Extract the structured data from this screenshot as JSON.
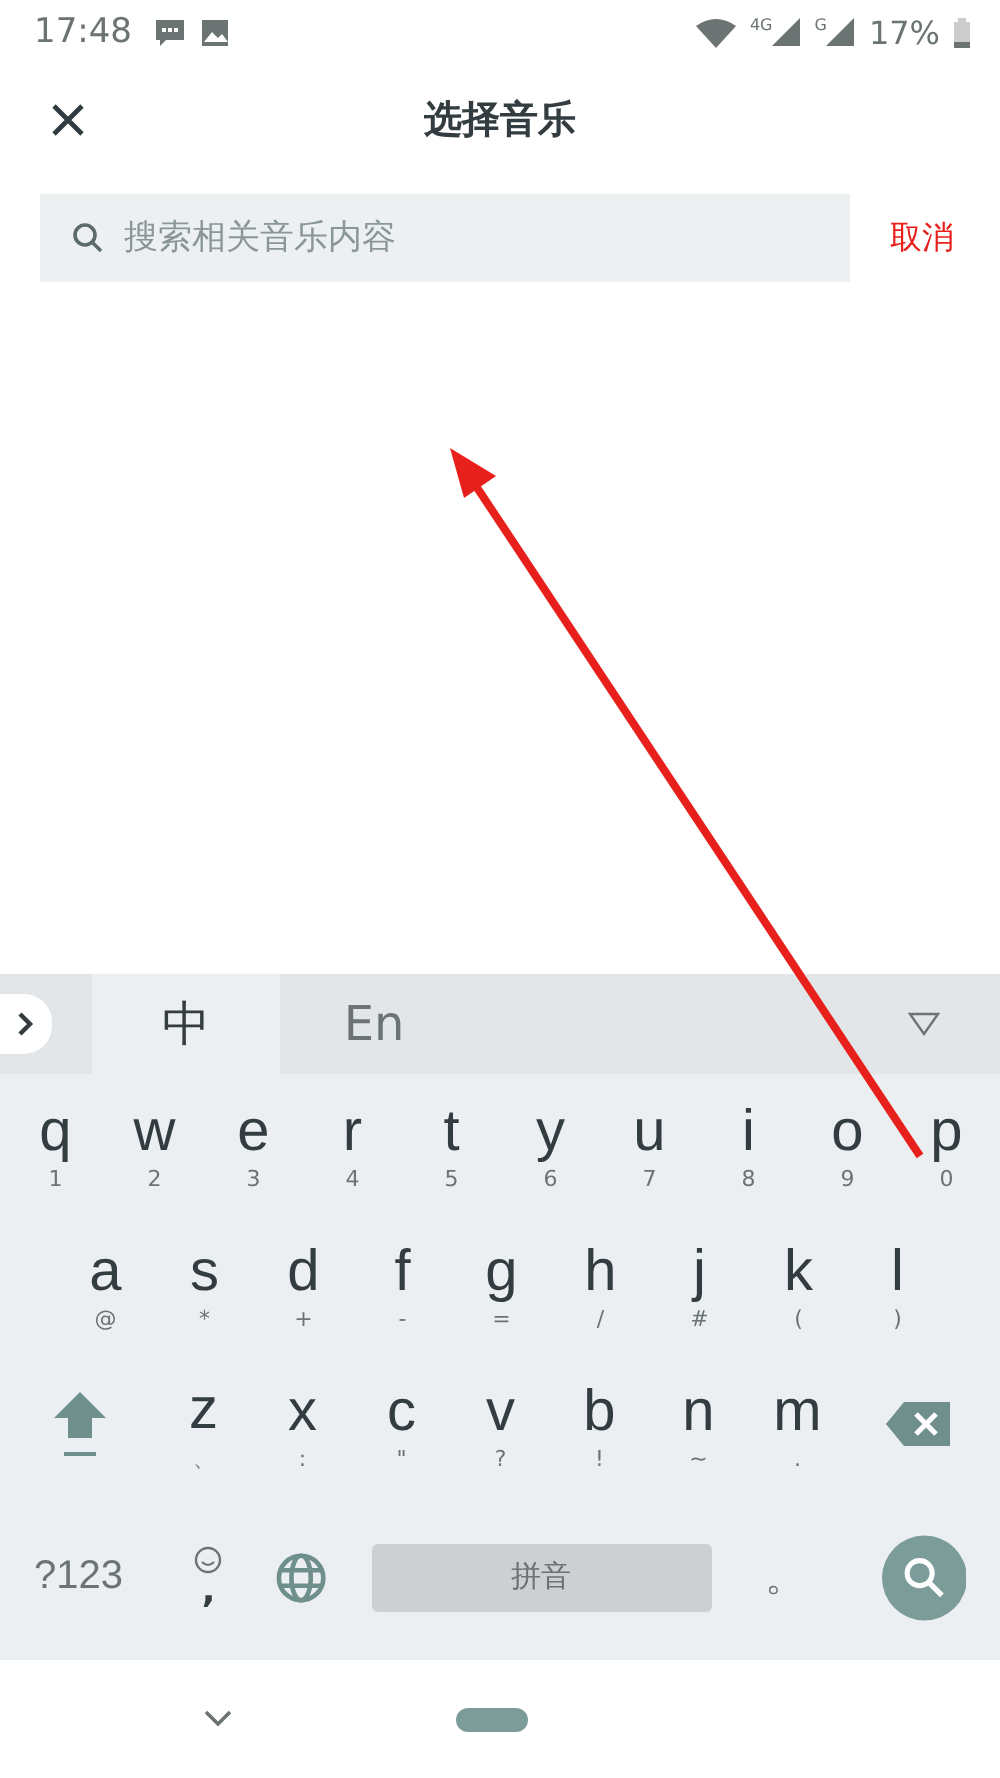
{
  "status_bar": {
    "time": "17:48",
    "network_1": "4G",
    "network_2": "G",
    "battery": "17%"
  },
  "header": {
    "title": "选择音乐"
  },
  "search": {
    "placeholder": "搜索相关音乐内容",
    "cancel": "取消"
  },
  "keyboard": {
    "tabs": [
      {
        "label": "中",
        "selected": true
      },
      {
        "label": "En",
        "selected": false
      }
    ],
    "rows": [
      [
        {
          "kind": "letter",
          "key": "q",
          "hint": "1"
        },
        {
          "kind": "letter",
          "key": "w",
          "hint": "2"
        },
        {
          "kind": "letter",
          "key": "e",
          "hint": "3"
        },
        {
          "kind": "letter",
          "key": "r",
          "hint": "4"
        },
        {
          "kind": "letter",
          "key": "t",
          "hint": "5"
        },
        {
          "kind": "letter",
          "key": "y",
          "hint": "6"
        },
        {
          "kind": "letter",
          "key": "u",
          "hint": "7"
        },
        {
          "kind": "letter",
          "key": "i",
          "hint": "8"
        },
        {
          "kind": "letter",
          "key": "o",
          "hint": "9"
        },
        {
          "kind": "letter",
          "key": "p",
          "hint": "0"
        }
      ],
      [
        {
          "kind": "letter",
          "key": "a",
          "hint": "@"
        },
        {
          "kind": "letter",
          "key": "s",
          "hint": "*"
        },
        {
          "kind": "letter",
          "key": "d",
          "hint": "+"
        },
        {
          "kind": "letter",
          "key": "f",
          "hint": "-"
        },
        {
          "kind": "letter",
          "key": "g",
          "hint": "="
        },
        {
          "kind": "letter",
          "key": "h",
          "hint": "/"
        },
        {
          "kind": "letter",
          "key": "j",
          "hint": "#"
        },
        {
          "kind": "letter",
          "key": "k",
          "hint": "("
        },
        {
          "kind": "letter",
          "key": "l",
          "hint": ")"
        }
      ],
      [
        {
          "kind": "shift"
        },
        {
          "kind": "letter",
          "key": "z",
          "hint": "、"
        },
        {
          "kind": "letter",
          "key": "x",
          "hint": ":"
        },
        {
          "kind": "letter",
          "key": "c",
          "hint": "\""
        },
        {
          "kind": "letter",
          "key": "v",
          "hint": "?"
        },
        {
          "kind": "letter",
          "key": "b",
          "hint": "!"
        },
        {
          "kind": "letter",
          "key": "n",
          "hint": "~"
        },
        {
          "kind": "letter",
          "key": "m",
          "hint": "."
        },
        {
          "kind": "backspace"
        }
      ]
    ],
    "bottom_row": [
      {
        "kind": "text",
        "key": "?123"
      },
      {
        "kind": "emoji",
        "key": ","
      },
      {
        "kind": "globe"
      },
      {
        "kind": "space",
        "key": "拼音"
      },
      {
        "kind": "text",
        "key": "。"
      },
      {
        "kind": "search"
      }
    ]
  }
}
